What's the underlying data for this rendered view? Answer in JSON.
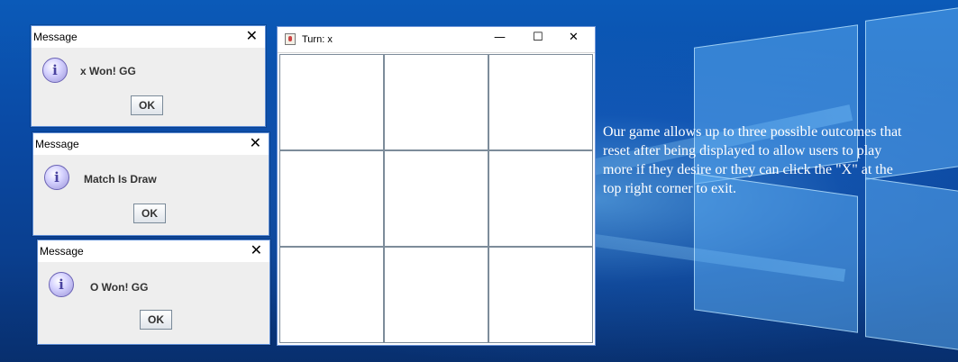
{
  "dialogs": [
    {
      "title": "Message",
      "close": "✕",
      "icon": "i",
      "message": "x Won! GG",
      "ok_label": "OK"
    },
    {
      "title": "Message",
      "close": "✕",
      "icon": "i",
      "message": "Match Is Draw",
      "ok_label": "OK"
    },
    {
      "title": "Message",
      "close": "✕",
      "icon": "i",
      "message": "O Won! GG",
      "ok_label": "OK"
    }
  ],
  "game_window": {
    "title": "Turn: x",
    "minimize": "—",
    "maximize": "☐",
    "close": "✕"
  },
  "description": "Our game allows up to three possible outcomes that reset after being displayed to allow users to play more if they desire or they can click the \"X\" at the top right corner to exit.",
  "colors": {
    "desktop": "#0a4aa5",
    "dialog_bg": "#eeeeee",
    "window_border": "#6e95d8",
    "grid_line": "#7d8c9a"
  }
}
